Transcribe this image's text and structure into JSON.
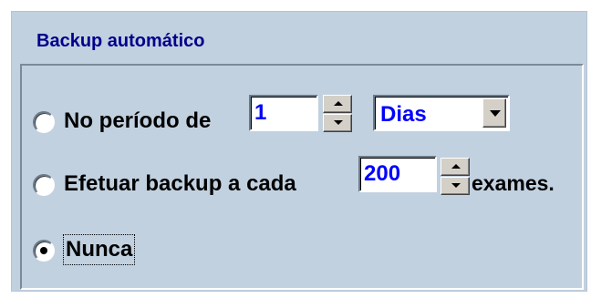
{
  "group": {
    "title": "Backup automático"
  },
  "options": {
    "period": {
      "label": "No período de",
      "value": "1",
      "unit": "Dias",
      "selected": false
    },
    "exams": {
      "label": "Efetuar backup a cada",
      "value": "200",
      "suffix": "exames.",
      "selected": false
    },
    "never": {
      "label": "Nunca",
      "selected": true
    }
  },
  "icons": {
    "spin_up": "arrow-up-icon",
    "spin_down": "arrow-down-icon",
    "dropdown": "chevron-down-icon"
  },
  "colors": {
    "background": "#c2d1e0",
    "title": "#00008b",
    "value_text": "#0000ff"
  }
}
